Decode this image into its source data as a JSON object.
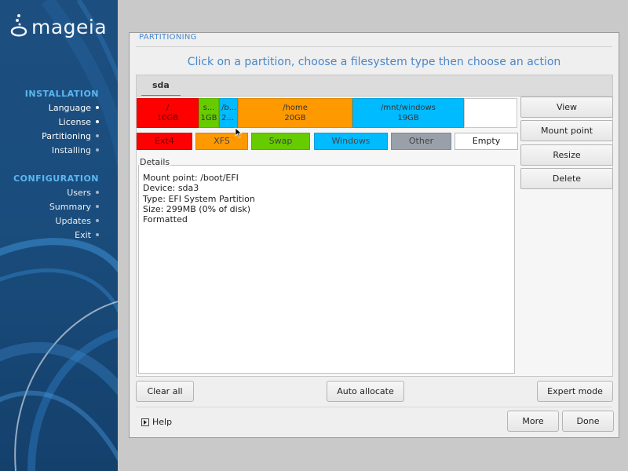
{
  "sidebar": {
    "logo_text": "mageia",
    "installation": {
      "title": "INSTALLATION",
      "steps": [
        "Language",
        "License",
        "Partitioning",
        "Installing"
      ]
    },
    "configuration": {
      "title": "CONFIGURATION",
      "steps": [
        "Users",
        "Summary",
        "Updates",
        "Exit"
      ]
    }
  },
  "dialog": {
    "header_title": "PARTITIONING",
    "instruction": "Click on a partition, choose a filesystem type then choose an action",
    "disk_tab": "sda",
    "partitions": [
      {
        "label": "/",
        "size": "10GB",
        "type": "Ext4",
        "color": "#ff0000"
      },
      {
        "label": "s...",
        "size": "1GB",
        "type": "Swap",
        "color": "#66cc00"
      },
      {
        "label": "/b...",
        "size": "2...",
        "type": "Windows",
        "color": "#00bbff"
      },
      {
        "label": "/home",
        "size": "20GB",
        "type": "XFS",
        "color": "#ff9900"
      },
      {
        "label": "/mnt/windows",
        "size": "19GB",
        "type": "Windows",
        "color": "#00bbff"
      },
      {
        "label": "",
        "size": "",
        "type": "Empty",
        "color": "#ffffff"
      }
    ],
    "legend": [
      {
        "label": "Ext4",
        "color": "#ff0000"
      },
      {
        "label": "XFS",
        "color": "#ff9900"
      },
      {
        "label": "Swap",
        "color": "#66cc00"
      },
      {
        "label": "Windows",
        "color": "#00bbff"
      },
      {
        "label": "Other",
        "color": "#99a0aa"
      },
      {
        "label": "Empty",
        "color": "#ffffff"
      }
    ],
    "actions": [
      "View",
      "Mount point",
      "Resize",
      "Delete"
    ],
    "details": {
      "legend": "Details",
      "lines": [
        "Mount point: /boot/EFI",
        "Device: sda3",
        "Type: EFI System Partition",
        "Size: 299MB (0% of disk)",
        "Formatted"
      ]
    },
    "buttons": {
      "clear_all": "Clear all",
      "auto_allocate": "Auto allocate",
      "expert_mode": "Expert mode",
      "help": "Help",
      "more": "More",
      "done": "Done"
    }
  },
  "colors": {
    "accent": "#4a86c8",
    "sidebar_section": "#5cb7f0"
  }
}
